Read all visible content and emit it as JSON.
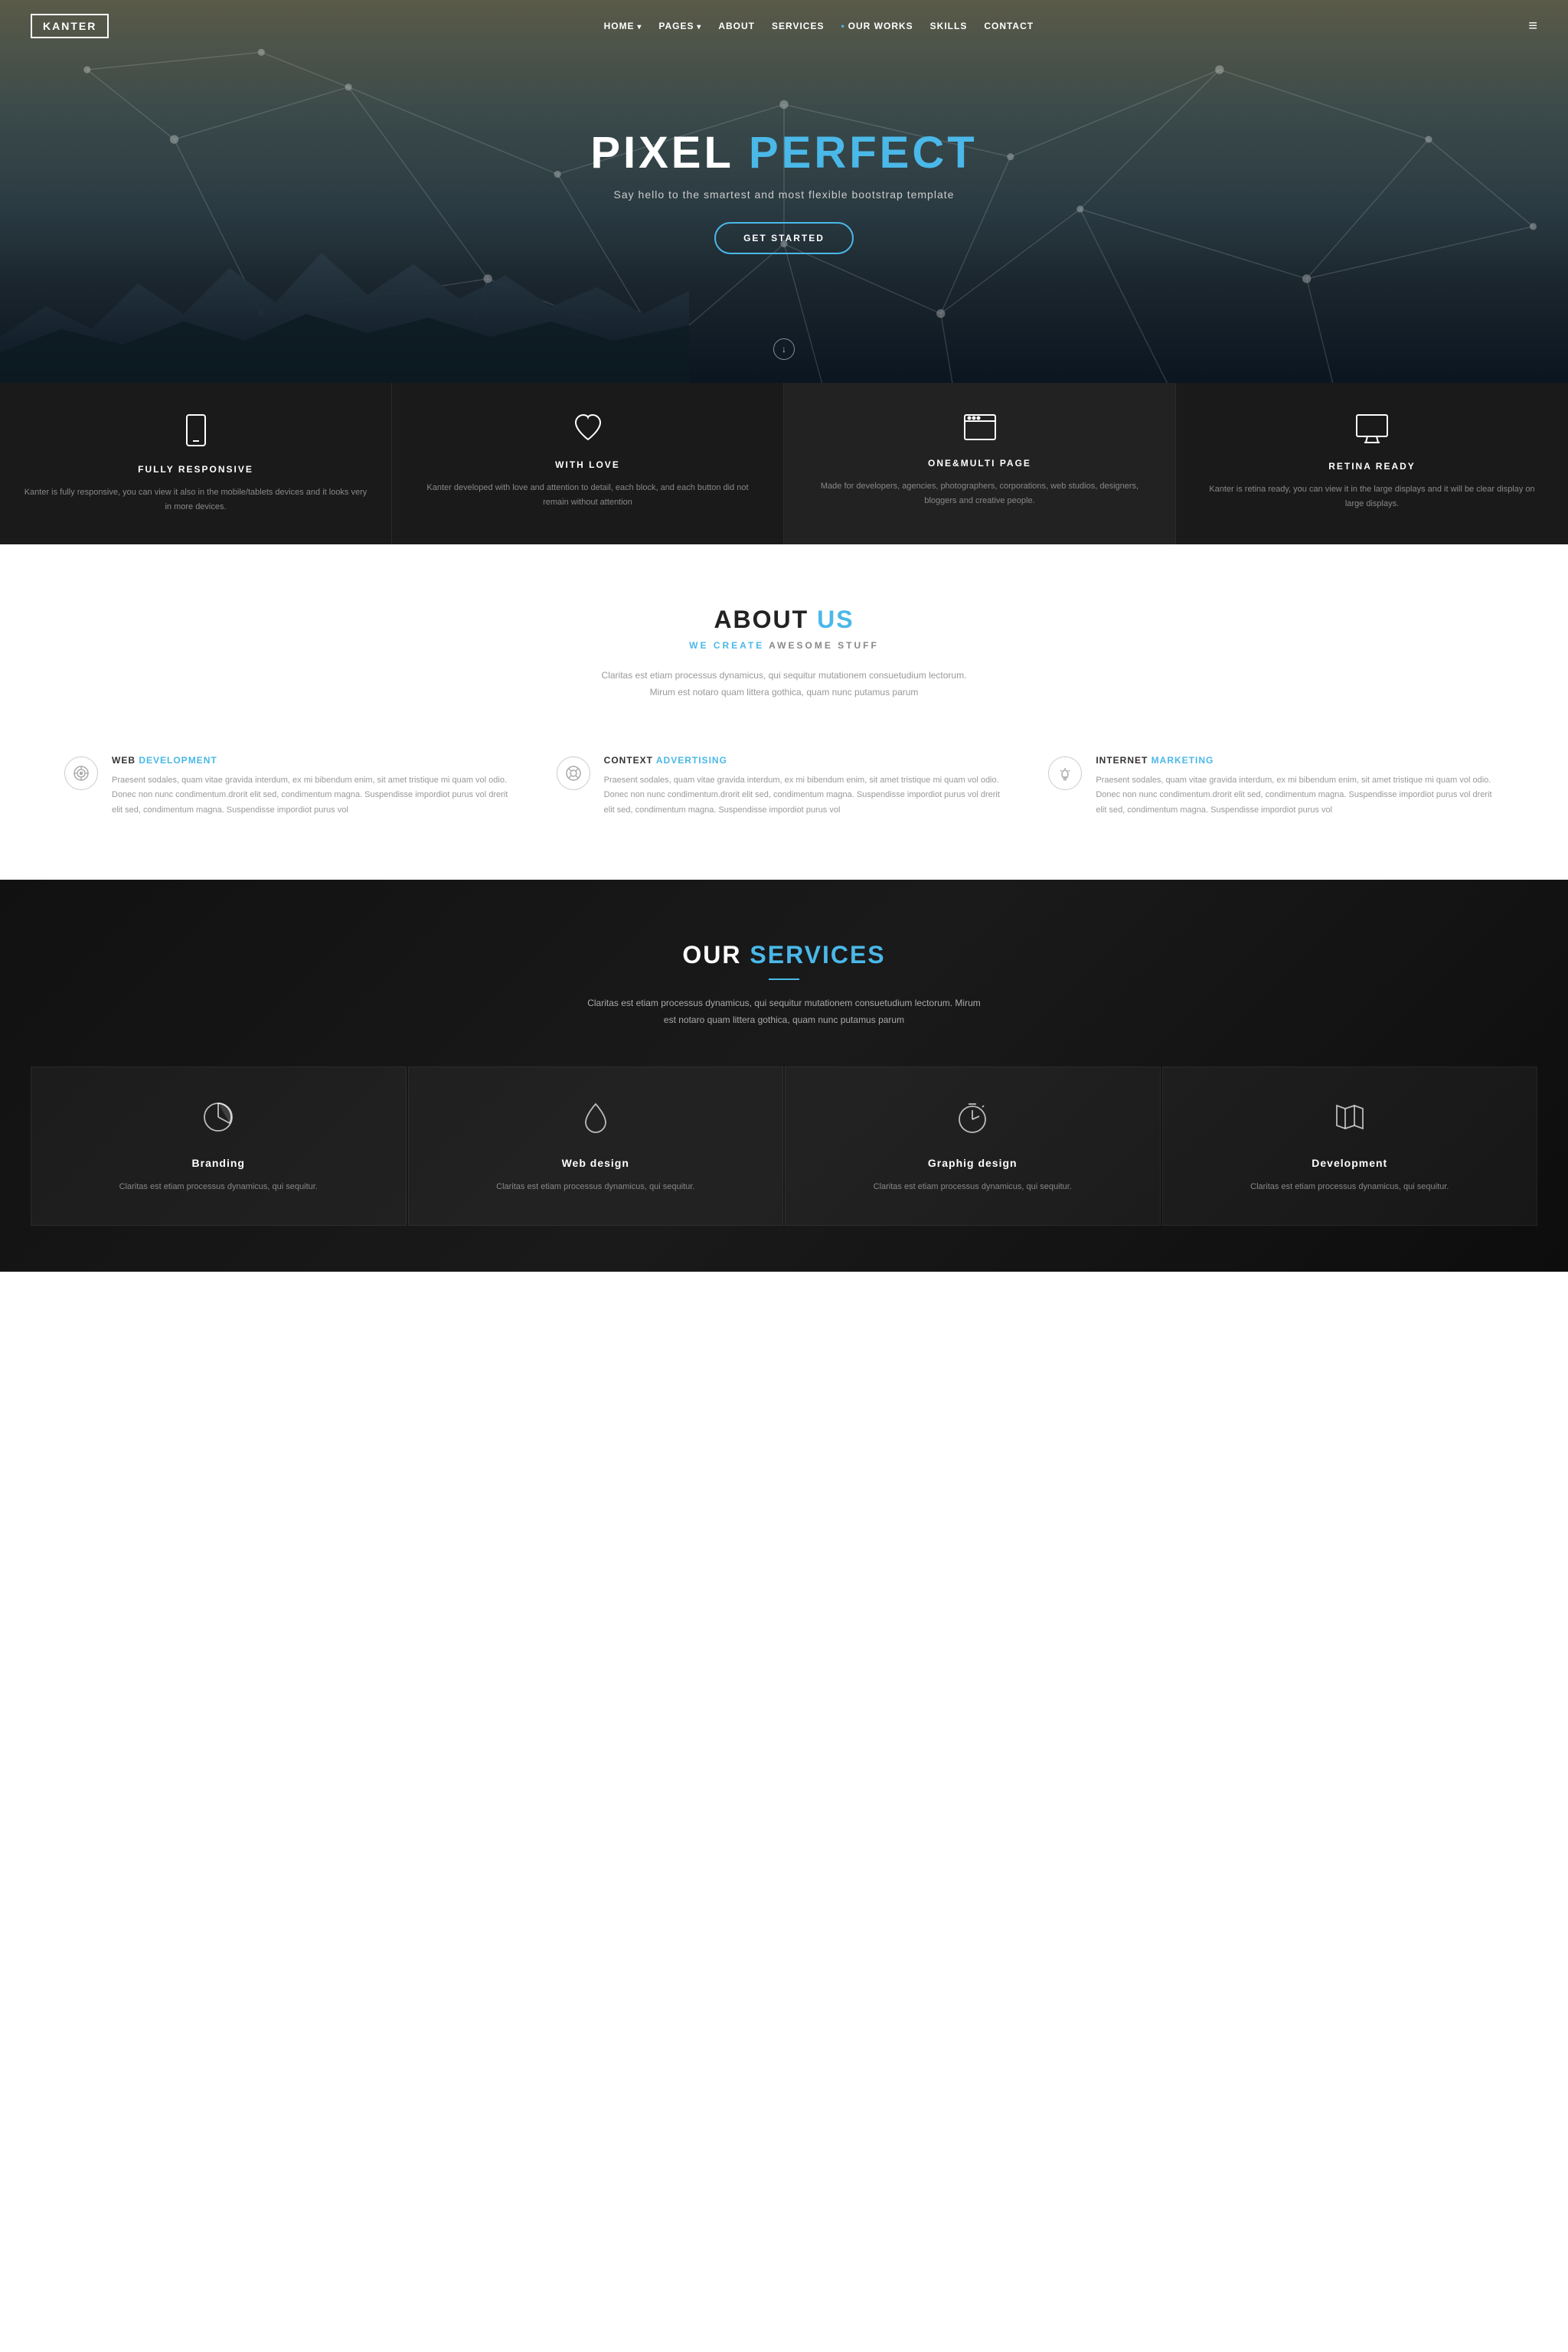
{
  "nav": {
    "logo": "KANTER",
    "links": [
      {
        "label": "HOME",
        "hasArrow": true,
        "dot": false
      },
      {
        "label": "PAGES",
        "hasArrow": true,
        "dot": false
      },
      {
        "label": "ABOUT",
        "hasArrow": false,
        "dot": false
      },
      {
        "label": "SERVICES",
        "hasArrow": false,
        "dot": false
      },
      {
        "label": "OUR WORKS",
        "hasArrow": false,
        "dot": true
      },
      {
        "label": "SKILLS",
        "hasArrow": false,
        "dot": false
      },
      {
        "label": "CONTACT",
        "hasArrow": false,
        "dot": false
      }
    ]
  },
  "hero": {
    "title_white": "PIXEL ",
    "title_blue": "PERFECT",
    "subtitle": "Say hello to the smartest and most flexible bootstrap template",
    "button": "GET STARTED",
    "scroll_hint": "↓"
  },
  "features": [
    {
      "title": "FULLY RESPONSIVE",
      "desc": "Kanter is fully responsive, you can view it also in the mobile/tablets devices and it looks very in more devices."
    },
    {
      "title": "WITH LOVE",
      "desc": "Kanter developed with love and attention to detail, each block, and each button did not remain without attention"
    },
    {
      "title": "ONE&MULTI PAGE",
      "desc": "Made for developers, agencies, photographers, corporations, web studios, designers, bloggers and creative people."
    },
    {
      "title": "RETINA READY",
      "desc": "Kanter is retina ready, you can view it in the large displays and it will be clear display on large displays."
    }
  ],
  "about": {
    "title_white": "ABOUT ",
    "title_blue": "US",
    "subtitle_blue": "WE CREATE",
    "subtitle_rest": " AWESOME STUFF",
    "desc": "Claritas est etiam processus dynamicus, qui sequitur mutationem consuetudium lectorum. Mirum est notaro quam littera gothica, quam nunc putamus parum",
    "features": [
      {
        "title_white": "WEB ",
        "title_blue": "DEVELOPMENT",
        "desc": "Praesent sodales, quam vitae gravida interdum, ex mi bibendum enim, sit amet tristique mi quam vol odio. Donec non nunc condimentum.drorit elit sed, condimentum magna. Suspendisse impordiot purus vol drerit elit sed, condimentum magna. Suspendisse impordiot purus vol"
      },
      {
        "title_white": "CONTEXT ",
        "title_blue": "ADVERTISING",
        "desc": "Praesent sodales, quam vitae gravida interdum, ex mi bibendum enim, sit amet tristique mi quam vol odio. Donec non nunc condimentum.drorit elit sed, condimentum magna. Suspendisse impordiot purus vol drerit elit sed, condimentum magna. Suspendisse impordiot purus vol"
      },
      {
        "title_white": "INTERNET ",
        "title_blue": "MARKETING",
        "desc": "Praesent sodales, quam vitae gravida interdum, ex mi bibendum enim, sit amet tristique mi quam vol odio. Donec non nunc condimentum.drorit elit sed, condimentum magna. Suspendisse impordiot purus vol drerit elit sed, condimentum magna. Suspendisse impordiot purus vol"
      }
    ]
  },
  "services": {
    "title_white": "OUR ",
    "title_blue": "SERVICES",
    "desc": "Claritas est etiam processus dynamicus, qui sequitur mutationem consuetudium lectorum. Mirum est notaro quam littera gothica, quam nunc putamus parum",
    "cards": [
      {
        "title": "Branding",
        "desc": "Claritas est etiam processus dynamicus, qui sequitur."
      },
      {
        "title": "Web design",
        "desc": "Claritas est etiam processus dynamicus, qui sequitur."
      },
      {
        "title": "Graphig design",
        "desc": "Claritas est etiam processus dynamicus, qui sequitur."
      },
      {
        "title": "Development",
        "desc": "Claritas est etiam processus dynamicus, qui sequitur."
      }
    ]
  },
  "colors": {
    "accent": "#4ab8e8",
    "dark_bg": "#1a1a1a",
    "hero_bg": "#4a4a3a"
  }
}
